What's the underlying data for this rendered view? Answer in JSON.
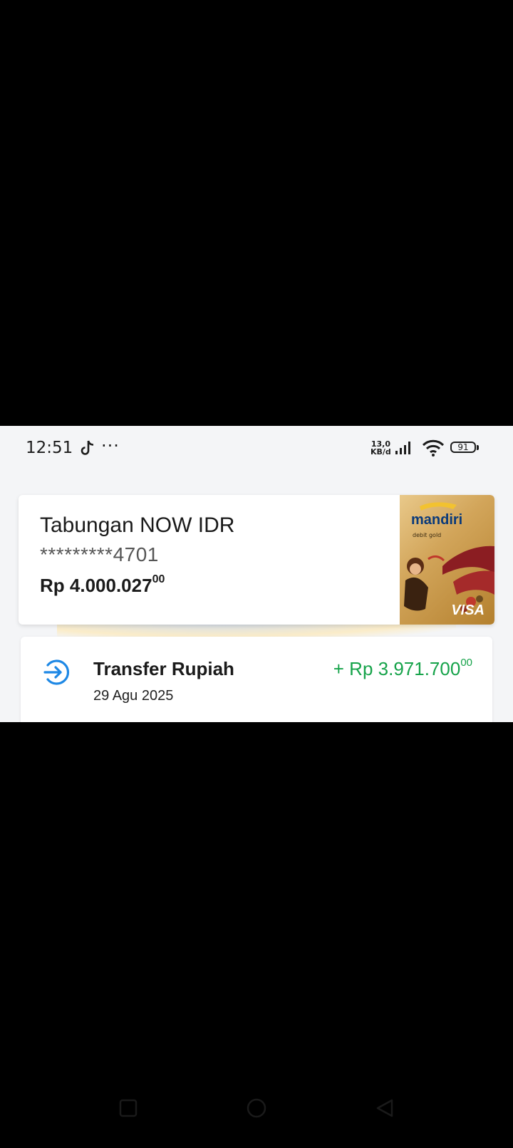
{
  "status_bar": {
    "time": "12:51",
    "notification_icons": [
      "tiktok-icon",
      "more-dots-icon"
    ],
    "more_dots": "···",
    "net_speed_value": "13,0",
    "net_speed_unit": "KB/d",
    "battery_level": "91"
  },
  "account_card": {
    "name": "Tabungan NOW IDR",
    "number": "*********4701",
    "balance_main": "Rp 4.000.027",
    "balance_cents": "00",
    "debit_card": {
      "bank_name": "mandiri",
      "card_type": "debit gold",
      "network": "VISA"
    }
  },
  "transactions": [
    {
      "icon": "transfer-in-icon",
      "title": "Transfer Rupiah",
      "date": "29 Agu 2025",
      "amount_main": "+ Rp 3.971.700",
      "amount_cents": "00",
      "amount_color": "#16a34a"
    }
  ],
  "colors": {
    "accent_blue": "#1e88e5",
    "credit_green": "#16a34a",
    "card_gold": "#d2a55a"
  }
}
